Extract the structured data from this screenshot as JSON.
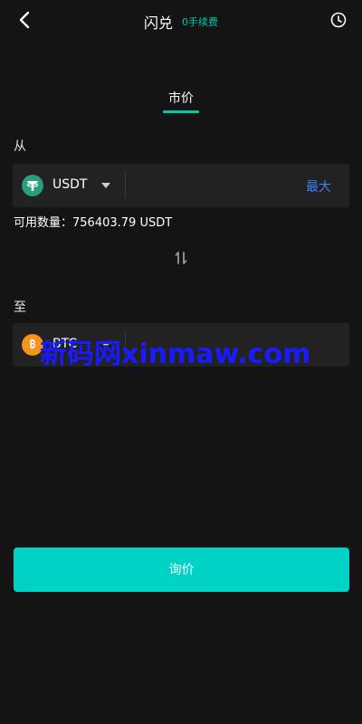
{
  "header": {
    "title": "闪兑",
    "fee_note": "0手续费"
  },
  "tab": {
    "label": "市价"
  },
  "from": {
    "label": "从",
    "coin": "USDT",
    "amount_placeholder": "",
    "max_label": "最大",
    "available_label": "可用数量：",
    "available_value": "756403.79 USDT"
  },
  "to": {
    "label": "至",
    "coin": "BTC",
    "amount_placeholder": ""
  },
  "watermark": {
    "text": "新码网xinmaw.com"
  },
  "actions": {
    "quote_label": "询价"
  },
  "colors": {
    "background": "#141414",
    "accent": "#00c9a7",
    "button": "#00d3c5",
    "link": "#3b82f6",
    "row_bg": "#222222"
  },
  "icons": {
    "back": "chevron-left-icon",
    "history": "clock-icon",
    "swap": "swap-arrows-icon",
    "usdt": "tether-icon",
    "btc": "bitcoin-icon"
  }
}
